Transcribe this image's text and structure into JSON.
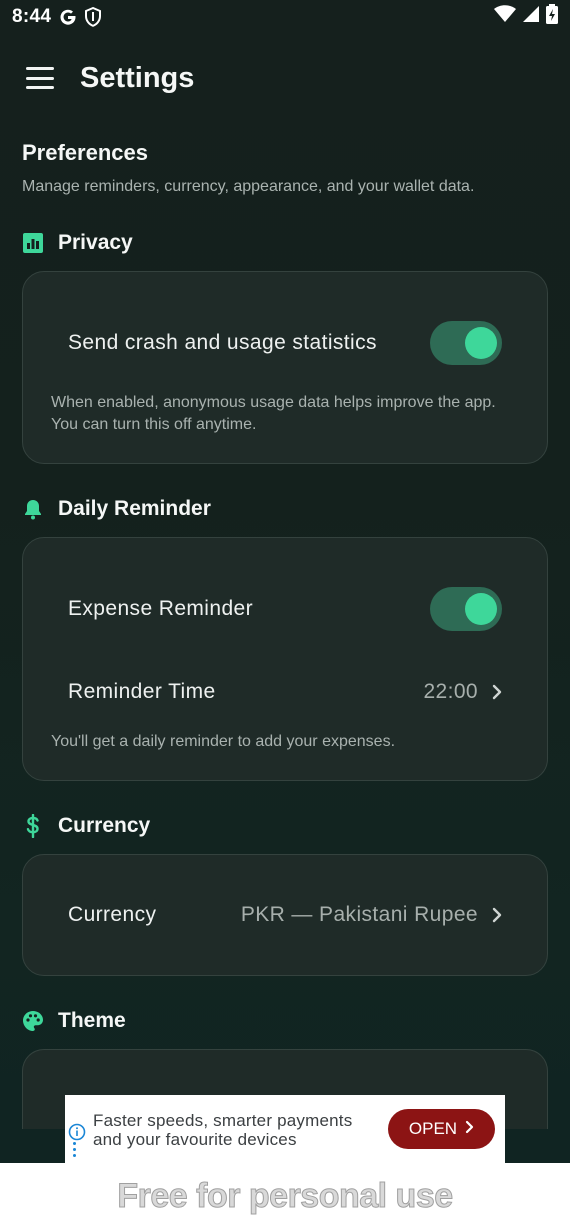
{
  "status_bar": {
    "time": "8:44"
  },
  "app_bar": {
    "title": "Settings"
  },
  "intro": {
    "title": "Preferences",
    "subtitle": "Manage reminders, currency, appearance, and your wallet data."
  },
  "sections": {
    "privacy": {
      "title": "Privacy",
      "stats_label": "Send crash and usage statistics",
      "stats_enabled": true,
      "help_line1": "When enabled, anonymous usage data helps improve the app.",
      "help_line2": "You can turn this off anytime."
    },
    "reminder": {
      "title": "Daily Reminder",
      "expense_label": "Expense Reminder",
      "expense_enabled": true,
      "time_label": "Reminder Time",
      "time_value": "22:00",
      "help": "You'll get a daily reminder to add your expenses."
    },
    "currency": {
      "title": "Currency",
      "label": "Currency",
      "value": "PKR — Pakistani Rupee"
    },
    "theme": {
      "title": "Theme"
    }
  },
  "ad": {
    "line1": "Faster speeds, smarter payments",
    "line2": "and your favourite devices",
    "button": "OPEN"
  },
  "watermark": "Free for personal use",
  "colors": {
    "accent": "#3ed79a",
    "toggle_track": "#2e6b55",
    "card_bg": "#1f2b28",
    "ad_button": "#8c1414"
  }
}
